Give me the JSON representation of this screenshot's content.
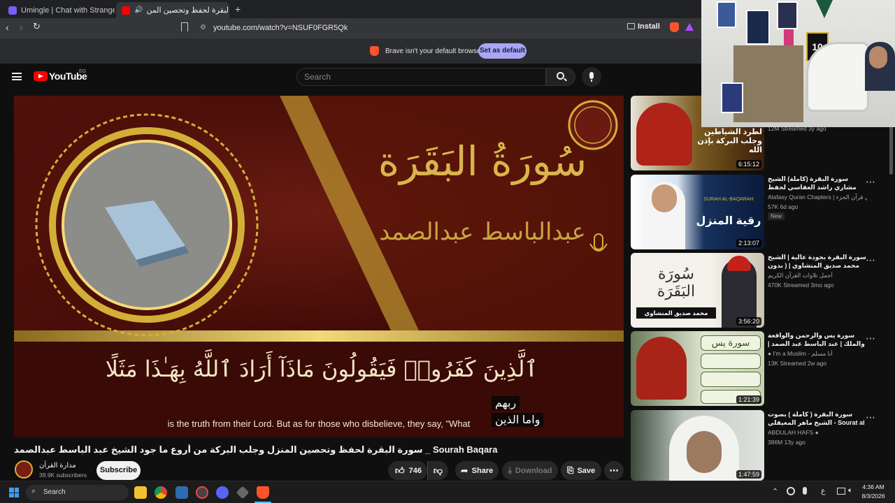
{
  "browser": {
    "tabs": [
      {
        "title": "Umingle | Chat with Strangers Instan"
      },
      {
        "title": "سورة البقرة لحفظ وتحصين المن"
      }
    ],
    "url": "youtube.com/watch?v=NSUF0FGR5Qk",
    "install_label": "Install",
    "infobar": {
      "message": "Brave isn't your default browser",
      "button": "Set as default"
    }
  },
  "youtube": {
    "logo_text": "YouTube",
    "country_code": "EG",
    "search_placeholder": "Search"
  },
  "video": {
    "title": "سورة البقرة لحفظ وتحصين المنزل وجلب البركة من أروع ما جود الشيخ عبد الباسط عبدالصمد _ Sourah Baqara",
    "overlay_title": "سُورَةُ البَقَرَة",
    "overlay_reciter": "عبدالباسط عبدالصمد",
    "verse_arabic": "ٱلَّذِينَ كَفَرُوا۟ فَيَقُولُونَ مَاذَآ أَرَادَ ٱللَّهُ بِهَـٰذَا مَثَلًا",
    "english_caption": "is the truth from their Lord. But as for those who disbelieve, they say, \"What",
    "subtitle_line1": "ربهم",
    "subtitle_line2": "واما الذين",
    "channel_name": "مدارة القرآن",
    "subscribers": "39.9K subscribers",
    "subscribe_label": "Subscribe",
    "likes": "746",
    "share_label": "Share",
    "download_label": "Download",
    "save_label": "Save"
  },
  "recommendations": [
    {
      "title": "",
      "channel": "",
      "meta": "12M  Streamed 3y ago",
      "duration": "6:15:12",
      "thumb_text": "لطرد الشياطين وجلب البركة بإذن الله",
      "badge": ""
    },
    {
      "title": "سورة البقرة (كاملة) الشيخ مشاري راشد العفاسي لحفظ وتحصين المنزل- Surah Al",
      "channel": "Alafasy Quran Chapters | العفاسي قرآن الجزء",
      "meta": "57K  6d ago",
      "duration": "2:13:07",
      "thumb_text": "رقية المنزل",
      "thumb_sub": "SURAH AL-BAQARAH",
      "badge": "New"
    },
    {
      "title": "سورة البقرة بجودة عالية | الشيخ محمد صديق المنشاوي | ( بدون إعلانات ) | Surah Al",
      "channel": "أجمل تلاوات القرآن الكريم",
      "meta": "470K  Streamed 3mo ago",
      "duration": "3:56:20",
      "thumb_text": "محمد صديق المنشاوي",
      "badge": ""
    },
    {
      "title": "سورة يس والرحمن والواقعة والملك | عبد الباسط عبد الصمد | تلاوة رائعة | HD",
      "channel": "I'm a Muslim - أنا مسلم",
      "meta": "13K  Streamed 2w ago",
      "duration": "1:21:39",
      "thumb_text": "سورة يس",
      "badge": ""
    },
    {
      "title": "سورة البقرة ( كاملة ) بصوت الشيخ ماهر المعيقلي - Sourat al baqara maher",
      "channel": "ABDULAH HAFS",
      "meta": "386M  13y ago",
      "duration": "1:47:59",
      "thumb_text": "",
      "badge": ""
    }
  ],
  "taskbar": {
    "search_label": "Search",
    "time": "4:36 AM",
    "date": "8/3/2026",
    "lang": "ع"
  },
  "colors": {
    "accent_red": "#ff0000",
    "brave_orange": "#fb542b",
    "gold": "#d4af37"
  }
}
